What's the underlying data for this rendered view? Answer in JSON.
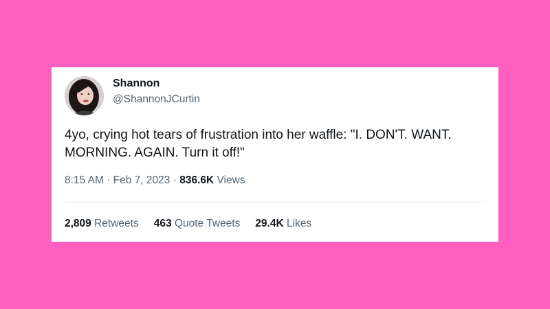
{
  "user": {
    "display_name": "Shannon",
    "handle": "@ShannonJCurtin",
    "avatar_icon": "avatar-photo"
  },
  "tweet": {
    "text_line1": "4yo, crying hot tears of frustration into her waffle: \"I. DON'T. WANT.",
    "text_line2": "MORNING. AGAIN. Turn it off!\"",
    "time": "8:15 AM",
    "separator": "·",
    "date": "Feb 7, 2023",
    "views_count": "836.6K",
    "views_label": "Views"
  },
  "stats": {
    "retweets_count": "2,809",
    "retweets_label": "Retweets",
    "quotes_count": "463",
    "quotes_label": "Quote Tweets",
    "likes_count": "29.4K",
    "likes_label": "Likes"
  },
  "colors": {
    "background": "#ff5fbf",
    "card": "#ffffff",
    "text_primary": "#0f1419",
    "text_secondary": "#536471"
  }
}
